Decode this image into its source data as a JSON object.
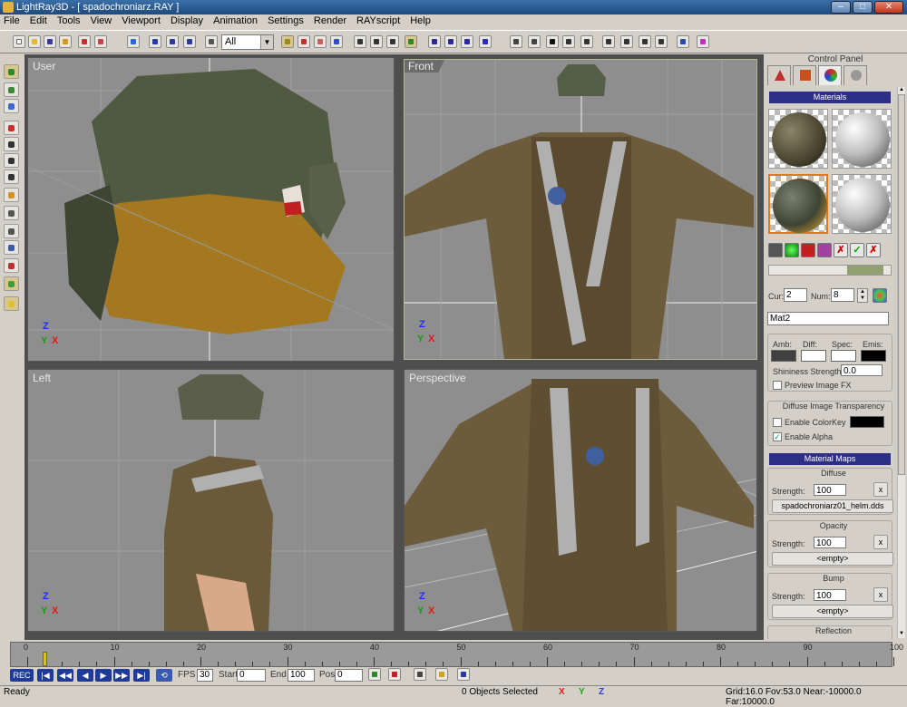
{
  "window": {
    "title": "LightRay3D - [ spadochroniarz.RAY ]",
    "min": "–",
    "max": "□",
    "close": "✕"
  },
  "menu": [
    "File",
    "Edit",
    "Tools",
    "View",
    "Viewport",
    "Display",
    "Animation",
    "Settings",
    "Render",
    "RAYscript",
    "Help"
  ],
  "toolbar": {
    "object_filter": "All"
  },
  "viewports": {
    "user": "User",
    "front": "Front",
    "left": "Left",
    "perspective": "Perspective",
    "axis_x": "X",
    "axis_y": "Y",
    "axis_z": "Z"
  },
  "control_panel": {
    "title": "Control Panel",
    "materials_header": "Materials",
    "cur_label": "Cur:",
    "cur_value": "2",
    "num_label": "Num:",
    "num_value": "8",
    "material_name": "Mat2",
    "amb_label": "Amb:",
    "diff_label": "Diff:",
    "spec_label": "Spec:",
    "emis_label": "Emis:",
    "shininess_label": "Shininess Strength:",
    "shininess_value": "0.0",
    "preview_fx_label": "Preview Image FX",
    "diffuse_transparency_title": "Diffuse Image Transparency",
    "enable_colorkey_label": "Enable ColorKey",
    "enable_alpha_label": "Enable Alpha",
    "material_maps_header": "Material Maps",
    "diffuse_title": "Diffuse",
    "diffuse_strength_label": "Strength:",
    "diffuse_strength": "100",
    "diffuse_file": "spadochroniarz01_helm.dds",
    "opacity_title": "Opacity",
    "opacity_strength_label": "Strength:",
    "opacity_strength": "100",
    "opacity_file": "<empty>",
    "bump_title": "Bump",
    "bump_strength_label": "Strength:",
    "bump_strength": "100",
    "bump_file": "<empty>",
    "reflection_title": "Reflection",
    "x_label": "x",
    "colors": {
      "amb": "#404040",
      "diff": "#ffffff",
      "spec": "#ffffff",
      "emis": "#000000",
      "colorkey": "#000000"
    }
  },
  "timeline": {
    "ticks": [
      "0",
      "10",
      "20",
      "30",
      "40",
      "50",
      "60",
      "70",
      "80",
      "90",
      "100"
    ],
    "current_frame": 2
  },
  "transport": {
    "rec": "REC",
    "fps_label": "FPS",
    "fps_value": "30",
    "start_label": "Start",
    "start_value": "0",
    "end_label": "End",
    "end_value": "100",
    "pos_label": "Pos",
    "pos_value": "0"
  },
  "status": {
    "ready": "Ready",
    "selection": "0 Objects Selected",
    "axis_x": "X",
    "axis_y": "Y",
    "axis_z": "Z",
    "grid_info": "Grid:16.0  Fov:53.0  Near:-10000.0  Far:10000.0"
  }
}
